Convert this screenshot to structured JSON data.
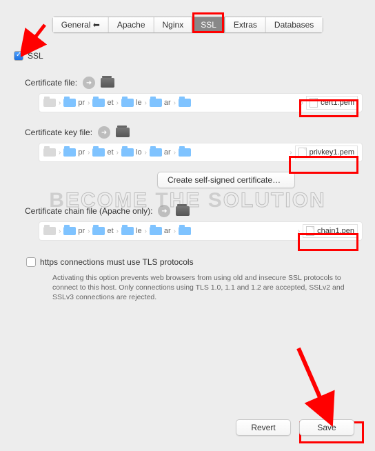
{
  "tabs": {
    "general": "General ⬅",
    "apache": "Apache",
    "nginx": "Nginx",
    "ssl": "SSL",
    "extras": "Extras",
    "databases": "Databases"
  },
  "ssl_checkbox_label": "SSL",
  "cert_file_label": "Certificate file:",
  "cert_key_label": "Certificate key file:",
  "cert_chain_label": "Certificate chain file (Apache only):",
  "breadcrumb_parts": {
    "p1": "pr",
    "p2": "et",
    "p3": "le",
    "p4": "ar"
  },
  "breadcrumb_parts2": {
    "p1": "pr",
    "p2": "et",
    "p3": "lo",
    "p4": "ar"
  },
  "files": {
    "cert": "cert1.pem",
    "key": "privkey1.pem",
    "chain": "chain1.pen"
  },
  "self_signed_btn": "Create self-signed certificate…",
  "tls_checkbox_label": "https connections must use TLS protocols",
  "tls_note": "Activating this option prevents web browsers from using old and insecure SSL protocols to connect to this host. Only connections using TLS 1.0, 1.1 and 1.2 are accepted, SSLv2 and SSLv3 connections are rejected.",
  "buttons": {
    "revert": "Revert",
    "save": "Save"
  },
  "watermark": "BECOME THE SOLUTION"
}
